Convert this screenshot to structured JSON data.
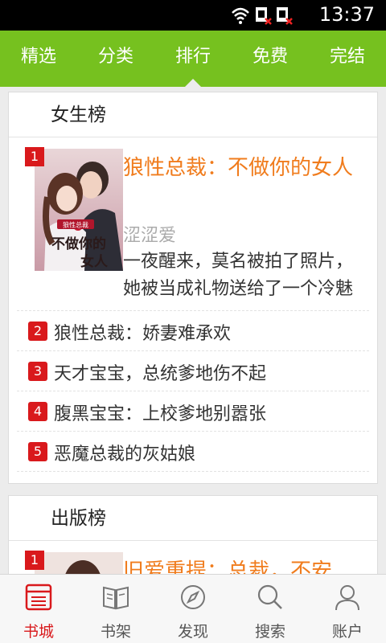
{
  "status": {
    "time": "13:37"
  },
  "topnav": {
    "tabs": [
      {
        "label": "精选"
      },
      {
        "label": "分类"
      },
      {
        "label": "排行"
      },
      {
        "label": "免费"
      },
      {
        "label": "完结"
      }
    ],
    "active_index": 2
  },
  "sections": {
    "female": {
      "title": "女生榜",
      "featured": {
        "rank": "1",
        "title": "狼性总裁：不做你的女人",
        "author": "涩涩爱",
        "description": "一夜醒来，莫名被拍了照片，她被当成礼物送给了一个冷魅",
        "cover_text_top": "狼性总裁",
        "cover_text_main": "不做你的女人"
      },
      "items": [
        {
          "rank": "2",
          "title": "狼性总裁：娇妻难承欢"
        },
        {
          "rank": "3",
          "title": "天才宝宝，总统爹地伤不起"
        },
        {
          "rank": "4",
          "title": "腹黑宝宝：上校爹地别嚣张"
        },
        {
          "rank": "5",
          "title": "恶魔总裁的灰姑娘"
        }
      ]
    },
    "publish": {
      "title": "出版榜",
      "featured": {
        "rank": "1",
        "title": "旧爱重提：总裁，不安"
      }
    }
  },
  "bottombar": {
    "tabs": [
      {
        "label": "书城",
        "icon": "bookstore-icon"
      },
      {
        "label": "书架",
        "icon": "bookshelf-icon"
      },
      {
        "label": "发现",
        "icon": "compass-icon"
      },
      {
        "label": "搜索",
        "icon": "search-icon"
      },
      {
        "label": "账户",
        "icon": "user-icon"
      }
    ],
    "active_index": 0
  },
  "colors": {
    "brand_green": "#76c11f",
    "title_orange": "#f07c1d",
    "rank_red": "#d9191c"
  }
}
